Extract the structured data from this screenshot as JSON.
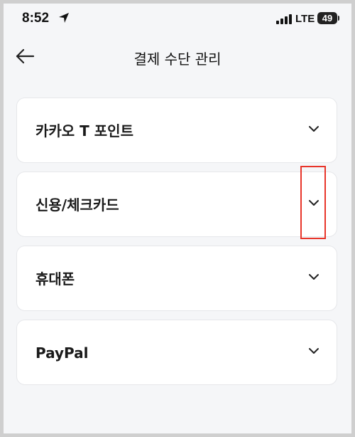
{
  "status_bar": {
    "time": "8:52",
    "network": "LTE",
    "battery": "49"
  },
  "header": {
    "title": "결제 수단 관리"
  },
  "payment_methods": [
    {
      "label": "카카오 T 포인트"
    },
    {
      "label": "신용/체크카드"
    },
    {
      "label": "휴대폰"
    },
    {
      "label": "PayPal"
    }
  ],
  "colors": {
    "background": "#f5f6f8",
    "card": "#ffffff",
    "highlight": "#e8352a"
  },
  "icons": {
    "back": "arrow-left-icon",
    "expand": "chevron-down-icon",
    "location": "location-arrow-icon",
    "signal": "cellular-signal-icon",
    "battery": "battery-icon"
  }
}
